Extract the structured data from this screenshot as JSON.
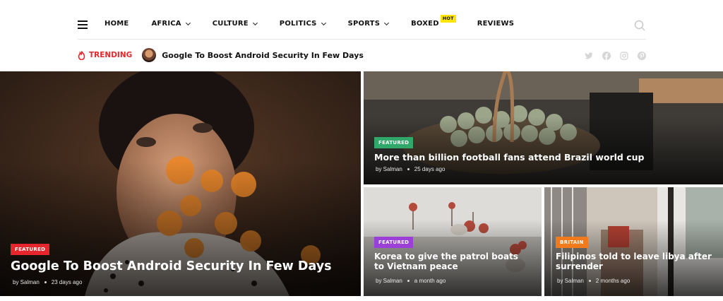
{
  "nav": {
    "items": [
      {
        "label": "HOME",
        "dropdown": false
      },
      {
        "label": "AFRICA",
        "dropdown": true
      },
      {
        "label": "CULTURE",
        "dropdown": true
      },
      {
        "label": "POLITICS",
        "dropdown": true
      },
      {
        "label": "SPORTS",
        "dropdown": true
      },
      {
        "label": "BOXED",
        "dropdown": false,
        "badge": "HOT"
      },
      {
        "label": "REVIEWS",
        "dropdown": false
      }
    ]
  },
  "trending": {
    "label": "TRENDING",
    "title": "Google To Boost Android Security In Few Days"
  },
  "socials": [
    "twitter-icon",
    "facebook-icon",
    "instagram-icon",
    "pinterest-icon"
  ],
  "cards": {
    "big": {
      "badge": "FEATURED",
      "badge_color": "#e5272d",
      "title": "Google To Boost Android Security In Few Days",
      "author": "by Salman",
      "time": "23 days ago"
    },
    "top_right": {
      "badge": "FEATURED",
      "badge_color": "#2fa86a",
      "title": "More than billion football fans attend Brazil world cup",
      "author": "by Salman",
      "time": "25 days ago"
    },
    "bottom_left": {
      "badge": "FEATURED",
      "badge_color": "#9b3fd6",
      "title": "Korea to give the patrol boats to Vietnam peace",
      "author": "by Salman",
      "time": "a month ago"
    },
    "bottom_right": {
      "badge": "BRITAIN",
      "badge_color": "#f07a1c",
      "title": "Filipinos told to leave libya after surrender",
      "author": "by Salman",
      "time": "2 months ago"
    }
  },
  "colors": {
    "accent": "#e5272d",
    "hot": "#ffe600"
  }
}
